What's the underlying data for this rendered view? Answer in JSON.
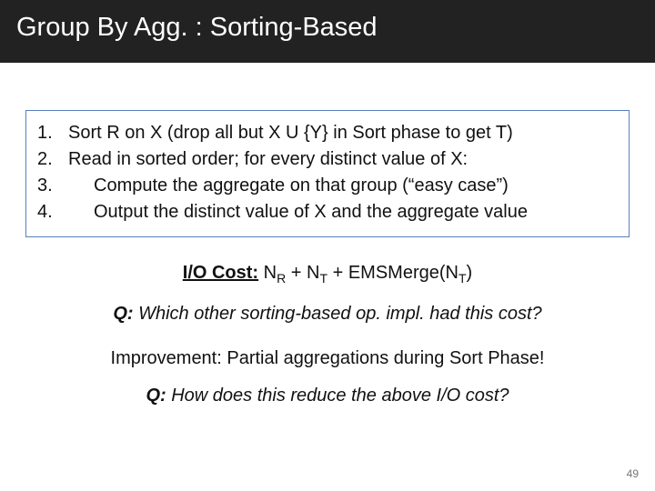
{
  "title": "Group By Agg. : Sorting-Based",
  "algo": {
    "items": [
      {
        "num": "1.",
        "text": "Sort R on X (drop all but X U {Y} in Sort phase to get T)",
        "indent": false
      },
      {
        "num": "2.",
        "text": "Read in sorted order; for every distinct value of X:",
        "indent": false
      },
      {
        "num": "3.",
        "text": "Compute the aggregate on that group (“easy case”)",
        "indent": true
      },
      {
        "num": "4.",
        "text": "Output the distinct value of X and the aggregate value",
        "indent": true
      }
    ]
  },
  "io_cost": {
    "label": "I/O Cost:",
    "pre": " N",
    "sub1": "R",
    "mid1": " + N",
    "sub2": "T",
    "mid2": " + EMSMerge(N",
    "sub3": "T",
    "post": ")"
  },
  "question1": {
    "q": "Q:",
    "text": " Which other sorting-based op. impl. had this cost?"
  },
  "improvement": "Improvement: Partial aggregations during Sort Phase!",
  "question2": {
    "q": "Q:",
    "text": " How does this reduce the above I/O cost?"
  },
  "page_number": "49"
}
